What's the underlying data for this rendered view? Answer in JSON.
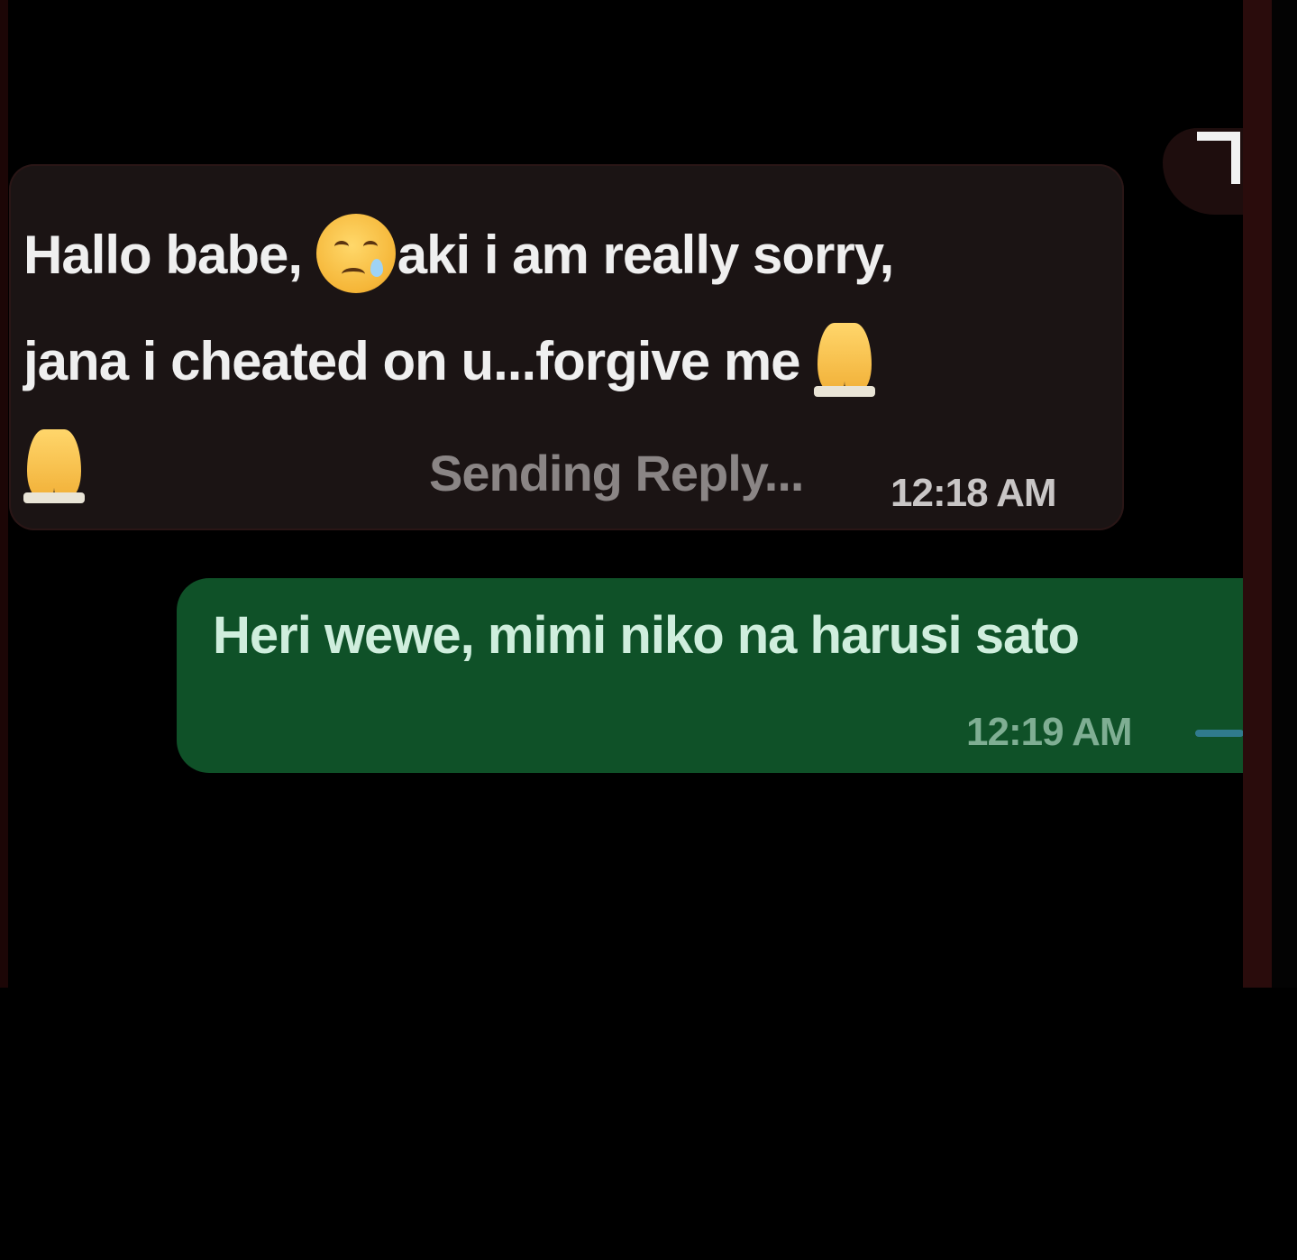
{
  "incoming_message": {
    "line1_part1": "Hallo babe, ",
    "line1_part2": "aki i am really sorry,",
    "line2": "jana i cheated on u...forgive me ",
    "emojis": [
      "sad-tear-face-icon",
      "praying-hands-icon",
      "praying-hands-icon"
    ],
    "status": "Sending Reply...",
    "time": "12:18 AM"
  },
  "outgoing_message": {
    "text": "Heri wewe, mimi niko na harusi sato",
    "time": "12:19 AM"
  },
  "colors": {
    "background": "#000000",
    "incoming_bubble": "#1b1414",
    "outgoing_bubble": "#0f5128",
    "read_tick": "#3f8db8"
  }
}
